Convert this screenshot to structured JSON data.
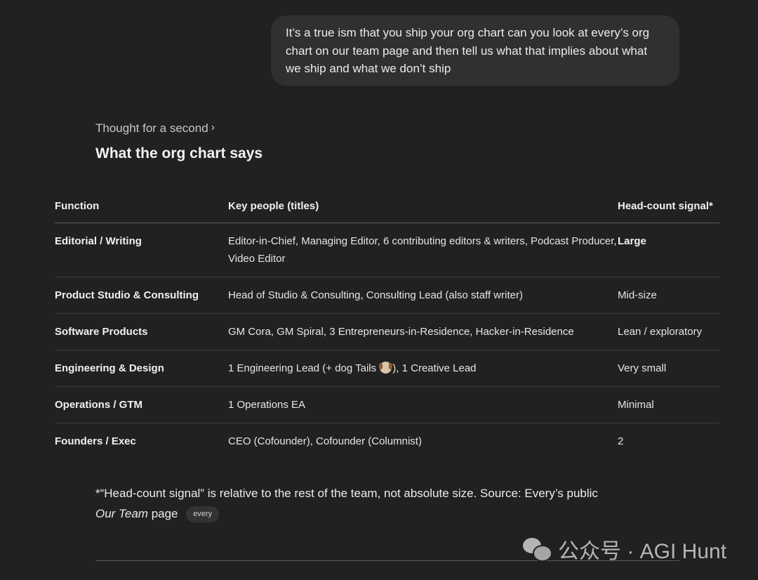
{
  "user_message": "It’s a true ism that you ship your org chart can you look at every’s org chart on our team page and then tell us what that implies about what we ship and what we don’t ship",
  "thought": {
    "label": "Thought for a second",
    "chevron_icon": "chevron-right-icon"
  },
  "heading": "What the org chart says",
  "table": {
    "headers": [
      "Function",
      "Key people (titles)",
      "Head-count signal*"
    ],
    "rows": [
      {
        "function": "Editorial / Writing",
        "people": "Editor-in-Chief, Managing Editor, 6 contributing editors & writers, Podcast Producer, Video Editor",
        "signal": "Large",
        "signal_bold": true
      },
      {
        "function": "Product Studio & Consulting",
        "people": "Head of Studio & Consulting, Consulting Lead (also staff writer)",
        "signal": "Mid-size"
      },
      {
        "function": "Software Products",
        "people": "GM Cora, GM Spiral, 3 Entrepreneurs-in-Residence, Hacker-in-Residence",
        "signal": "Lean / exploratory"
      },
      {
        "function": "Engineering & Design",
        "people_before": "1 Engineering Lead (+ dog Tails ",
        "people_icon": "dog-emoji-icon",
        "people_after": "), 1 Creative Lead",
        "signal": "Very small"
      },
      {
        "function": "Operations / GTM",
        "people": "1 Operations EA",
        "signal": "Minimal"
      },
      {
        "function": "Founders / Exec",
        "people": "CEO (Cofounder), Cofounder (Columnist)",
        "signal": "2"
      }
    ]
  },
  "footnote": {
    "text": "*“Head-count signal” is relative to the rest of the team, not absolute size. Source: Every’s public",
    "link_italic": "Our Team",
    "link_rest": " page",
    "chip": "every"
  },
  "watermark": {
    "text": "公众号 · AGI Hunt",
    "icon": "wechat-logo-icon"
  }
}
